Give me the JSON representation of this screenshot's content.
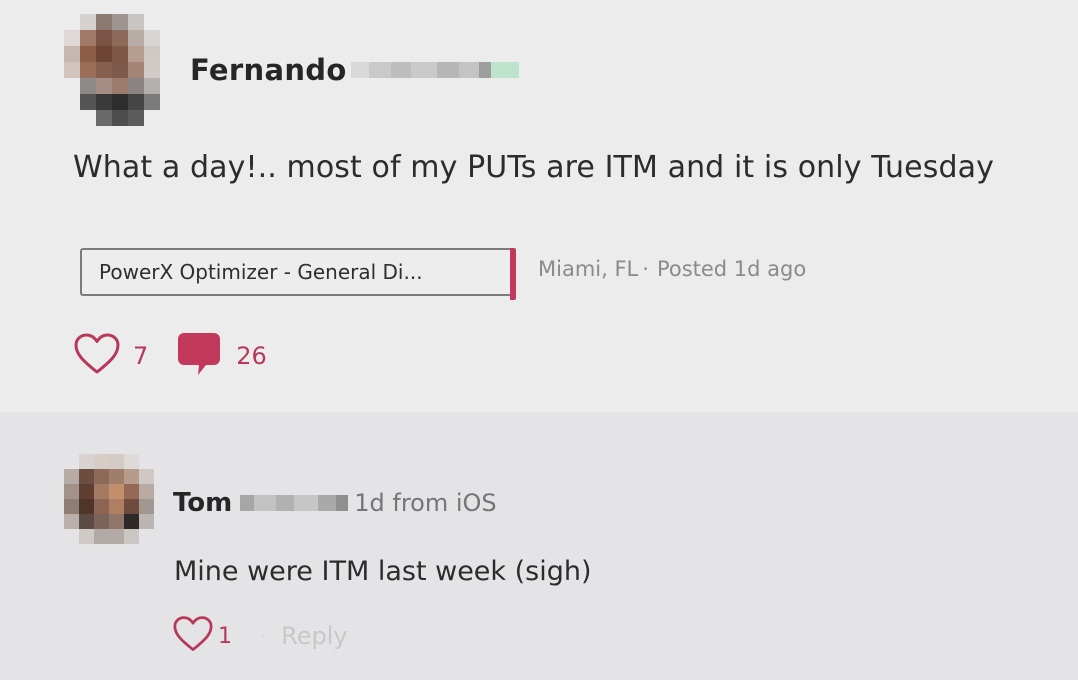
{
  "post": {
    "author": "Fernando",
    "text": "What a day!.. most of my PUTs are ITM and it is only Tuesday",
    "group": "PowerX Optimizer - General Di...",
    "location": "Miami, FL",
    "separator": "·",
    "posted": "Posted 1d ago",
    "likes": "7",
    "comments": "26",
    "accent_color": "#c2395c"
  },
  "comment": {
    "author": "Tom",
    "time": "1d from iOS",
    "text": "Mine were ITM last week (sigh)",
    "likes": "1",
    "separator": "·",
    "reply_label": "Reply"
  },
  "icons": {
    "like": "heart-outline-icon",
    "comment": "speech-bubble-icon"
  }
}
